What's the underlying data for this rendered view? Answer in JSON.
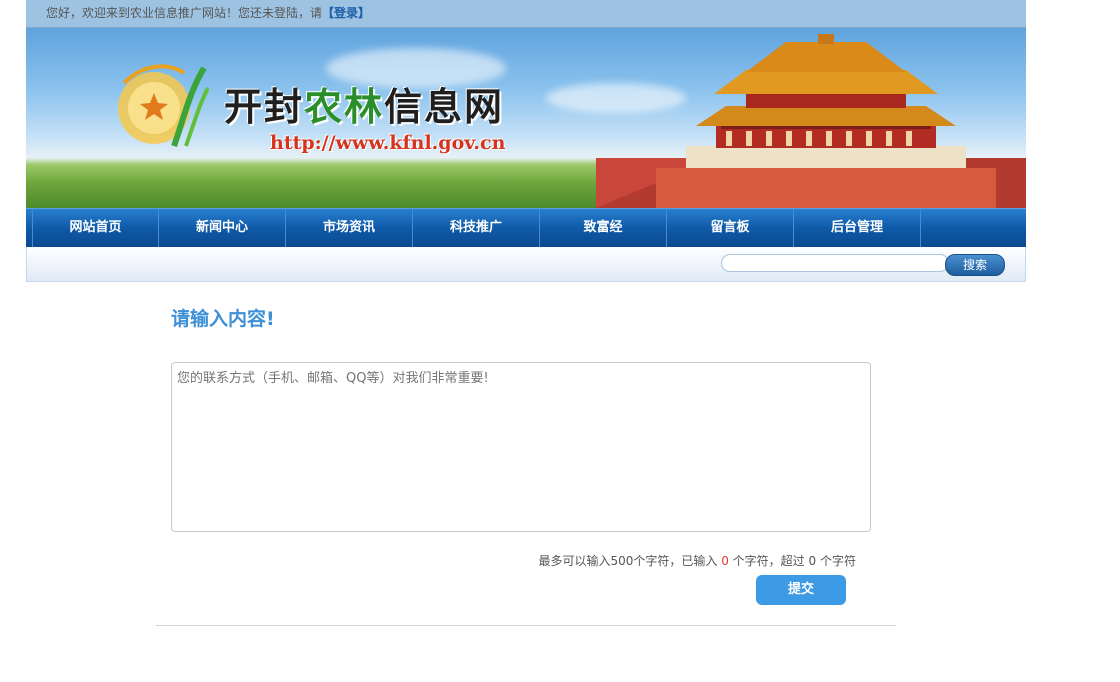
{
  "topbar": {
    "greeting": "您好，欢迎来到农业信息推广网站！您还未登陆，请",
    "login_label": "【登录】"
  },
  "banner": {
    "title_part1": "开封",
    "title_part2": "农林",
    "title_part3": "信息网",
    "url": "http://www.kfnl.gov.cn"
  },
  "nav": {
    "items": [
      "网站首页",
      "新闻中心",
      "市场资讯",
      "科技推广",
      "致富经",
      "留言板",
      "后台管理"
    ]
  },
  "search": {
    "value": "",
    "button_label": "搜索"
  },
  "form": {
    "heading": "请输入内容!",
    "textarea_placeholder": "您的联系方式（手机、邮箱、QQ等）对我们非常重要!",
    "counter_prefix": "最多可以输入500个字符，已输入",
    "counter_entered": "0",
    "counter_middle": "个字符，超过",
    "counter_exceeded": "0",
    "counter_suffix": "个字符",
    "submit_label": "提交"
  },
  "colors": {
    "nav_bg": "#0f5aa8",
    "heading": "#3d8fd6",
    "submit_bg": "#3d9ae4",
    "counter_highlight": "#e23b2e"
  }
}
